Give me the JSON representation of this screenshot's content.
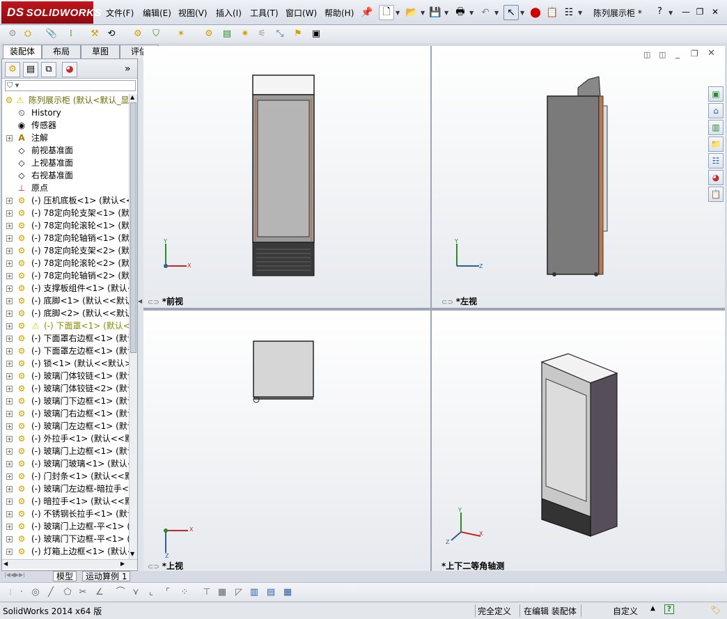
{
  "app": {
    "brand": "SOLIDWORKS",
    "brand_prefix": "DS",
    "document_title": "陈列展示柜 *"
  },
  "menu": [
    "文件(F)",
    "编辑(E)",
    "视图(V)",
    "插入(I)",
    "工具(T)",
    "窗口(W)",
    "帮助(H)"
  ],
  "command_tabs": [
    "装配体",
    "布局",
    "草图",
    "评估"
  ],
  "tree": {
    "root": "陈列展示柜 (默认<默认_显",
    "items": [
      {
        "label": "History",
        "icon": "history-icon"
      },
      {
        "label": "传感器",
        "icon": "sensor-icon"
      },
      {
        "label": "注解",
        "icon": "annotation-icon"
      },
      {
        "label": "前视基准面",
        "icon": "plane-icon"
      },
      {
        "label": "上视基准面",
        "icon": "plane-icon"
      },
      {
        "label": "右视基准面",
        "icon": "plane-icon"
      },
      {
        "label": "原点",
        "icon": "origin-icon"
      },
      {
        "label": "(-) 压机底板<1> (默认<<默"
      },
      {
        "label": "(-) 78定向轮支架<1> (默认"
      },
      {
        "label": "(-) 78定向轮滚轮<1> (默认"
      },
      {
        "label": "(-) 78定向轮轴销<1> (默认"
      },
      {
        "label": "(-) 78定向轮支架<2> (默认"
      },
      {
        "label": "(-) 78定向轮滚轮<2> (默认"
      },
      {
        "label": "(-) 78定向轮轴销<2> (默认"
      },
      {
        "label": "(-) 支撑板组件<1> (默认<"
      },
      {
        "label": "(-) 底脚<1> (默认<<默认>"
      },
      {
        "label": "(-) 底脚<2> (默认<<默认>"
      },
      {
        "label": "(-) 下面罩<1> (默认<<!",
        "warning": true
      },
      {
        "label": "(-) 下面罩右边框<1> (默认"
      },
      {
        "label": "(-) 下面罩左边框<1> (默认"
      },
      {
        "label": "(-) 锁<1> (默认<<默认>_显"
      },
      {
        "label": "(-) 玻璃门体铰链<1> (默认"
      },
      {
        "label": "(-) 玻璃门体铰链<2> (默认"
      },
      {
        "label": "(-) 玻璃门下边框<1> (默认"
      },
      {
        "label": "(-) 玻璃门右边框<1> (默认"
      },
      {
        "label": "(-) 玻璃门左边框<1> (默认"
      },
      {
        "label": "(-) 外拉手<1> (默认<<默认"
      },
      {
        "label": "(-) 玻璃门上边框<1> (默认"
      },
      {
        "label": "(-) 玻璃门玻璃<1> (默认<"
      },
      {
        "label": "(-) 门封条<1> (默认<<默认"
      },
      {
        "label": "(-) 玻璃门左边框-暗拉手<1"
      },
      {
        "label": "(-) 暗拉手<1> (默认<<默认"
      },
      {
        "label": "(-) 不锈钢长拉手<1> (默认"
      },
      {
        "label": "(-) 玻璃门上边框-平<1> (默"
      },
      {
        "label": "(-) 玻璃门下边框-平<1> (默"
      },
      {
        "label": "(-) 灯箱上边框<1> (默认<"
      }
    ]
  },
  "bottom_tabs": [
    "模型",
    "运动算例 1"
  ],
  "viewports": [
    {
      "label": "*前视",
      "axes": [
        "Y",
        "X"
      ]
    },
    {
      "label": "*左视",
      "axes": [
        "Y",
        "Z"
      ]
    },
    {
      "label": "*上视",
      "axes": [
        "Z",
        "X"
      ]
    },
    {
      "label": "*上下二等角轴测",
      "axes": [
        "Y",
        "X",
        "Z"
      ]
    }
  ],
  "status": {
    "app_version": "SolidWorks 2014 x64 版",
    "definition": "完全定义",
    "mode": "在编辑 装配体",
    "custom": "自定义"
  },
  "colors": {
    "brand_red": "#b3121a",
    "accent_blue": "#2f5d9e",
    "warning": "#e8c000"
  }
}
